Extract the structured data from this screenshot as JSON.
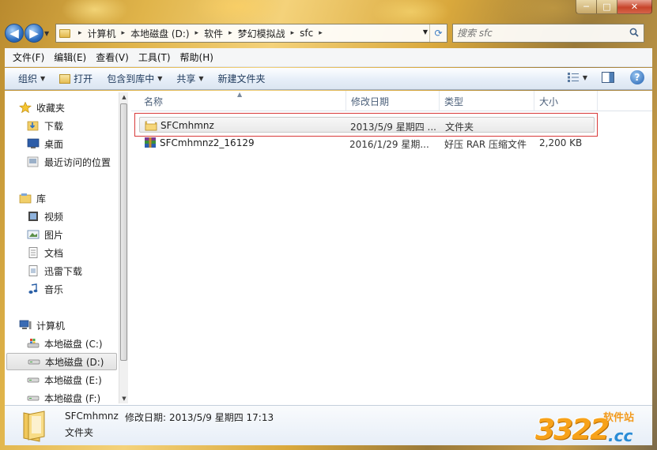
{
  "window": {
    "caption": {
      "minimize": "─",
      "maximize": "□",
      "close": "✕"
    }
  },
  "address": {
    "crumbs": [
      "计算机",
      "本地磁盘 (D:)",
      "软件",
      "梦幻模拟战",
      "sfc"
    ],
    "separator": "▸"
  },
  "search": {
    "placeholder": "搜索 sfc"
  },
  "menu": [
    "文件(F)",
    "编辑(E)",
    "查看(V)",
    "工具(T)",
    "帮助(H)"
  ],
  "toolbar": {
    "organize": "组织",
    "open": "打开",
    "include_library": "包含到库中",
    "share": "共享",
    "new_folder": "新建文件夹"
  },
  "nav": {
    "favorites": "收藏夹",
    "favorites_items": [
      "下载",
      "桌面",
      "最近访问的位置"
    ],
    "libraries": "库",
    "library_items": [
      "视频",
      "图片",
      "文档",
      "迅雷下载",
      "音乐"
    ],
    "computer": "计算机",
    "drives": [
      "本地磁盘 (C:)",
      "本地磁盘 (D:)",
      "本地磁盘 (E:)",
      "本地磁盘 (F:)"
    ],
    "selected_drive_index": 1
  },
  "columns": {
    "name": "名称",
    "date": "修改日期",
    "type": "类型",
    "size": "大小"
  },
  "files": [
    {
      "name": "SFCmhmnz",
      "date": "2013/5/9 星期四 ...",
      "type": "文件夹",
      "size": "",
      "icon": "folder-icon"
    },
    {
      "name": "SFCmhmnz2_16129",
      "date": "2016/1/29 星期...",
      "type": "好压 RAR 压缩文件",
      "size": "2,200 KB",
      "icon": "rar-archive-icon"
    }
  ],
  "details": {
    "name": "SFCmhmnz",
    "date_label": "修改日期:",
    "date_value": "2013/5/9 星期四 17:13",
    "type": "文件夹"
  },
  "watermark": {
    "number": "3322",
    "domain": ".cc",
    "site": "软件站"
  }
}
